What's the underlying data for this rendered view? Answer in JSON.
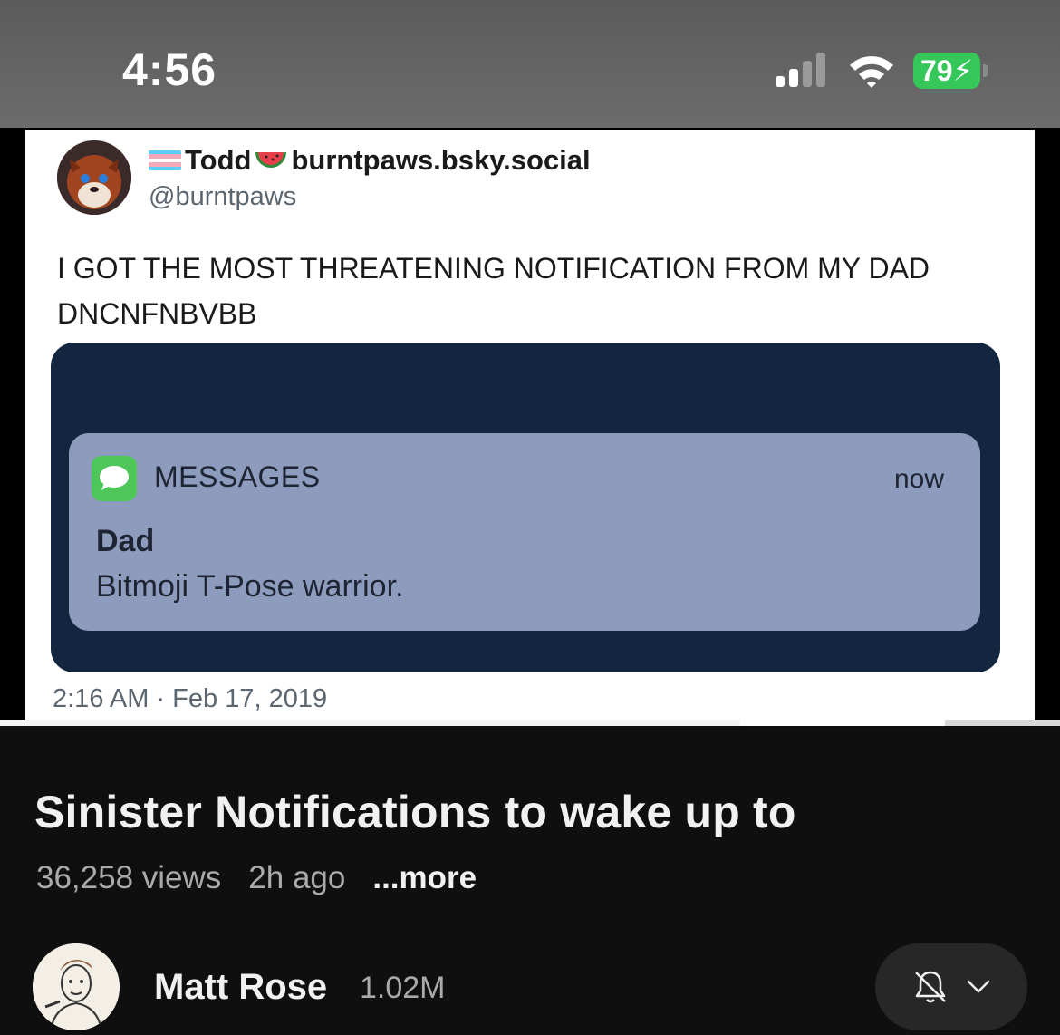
{
  "status_bar": {
    "time": "4:56",
    "battery": "79",
    "battery_color": "#35c759"
  },
  "tweet": {
    "display_name": "Todd",
    "display_name_suffix": "burntpaws.bsky.social",
    "handle": "@burntpaws",
    "text": "I GOT THE MOST THREATENING NOTIFICATION FROM MY DAD DNCNFNBVBB",
    "timestamp": "2:16 AM · Feb 17, 2019",
    "notification": {
      "app": "MESSAGES",
      "time": "now",
      "sender": "Dad",
      "body": "Bitmoji T-Pose warrior."
    }
  },
  "player": {
    "progress_fraction": 0.698
  },
  "video": {
    "title": "Sinister Notifications to wake up to",
    "views": "36,258 views",
    "age": "2h ago",
    "more": "...more"
  },
  "channel": {
    "name": "Matt Rose",
    "subscribers": "1.02M",
    "subscribe_icons": [
      "bell-off-icon",
      "chevron-down-icon"
    ]
  }
}
